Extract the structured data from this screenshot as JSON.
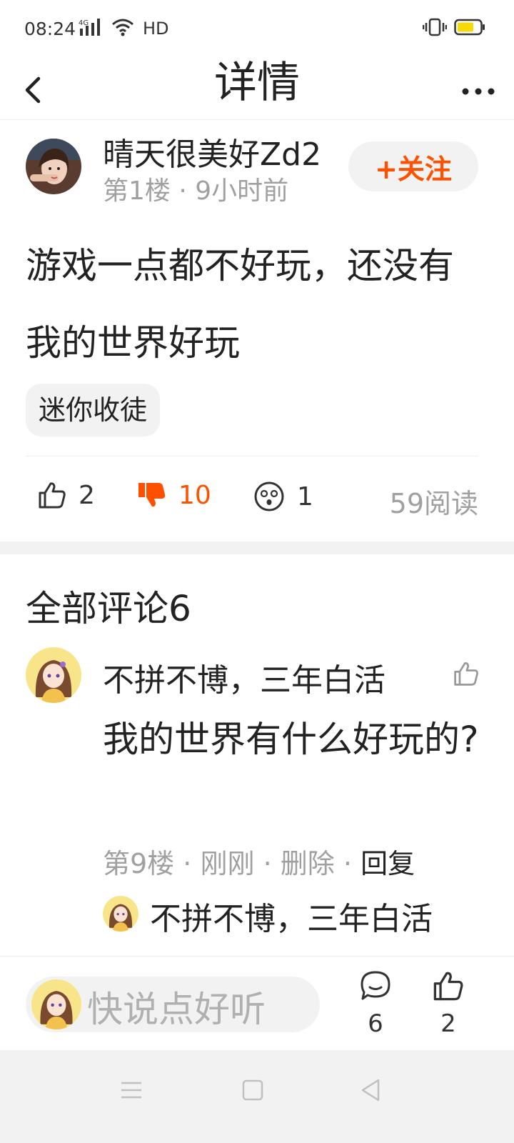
{
  "status_bar": {
    "time": "08:24",
    "network_label": "4G",
    "hd_label": "HD",
    "battery_color": "#f5d90a"
  },
  "nav": {
    "title": "详情",
    "back_icon": "chevron-left-icon",
    "more_icon": "more-horizontal-icon"
  },
  "post": {
    "author": "晴天很美好Zd2",
    "meta": "第1楼 · 9小时前",
    "follow_label": "+关注",
    "content": "游戏一点都不好玩，还没有我的世界好玩",
    "tag": "迷你收徒",
    "actions": {
      "like_count": "2",
      "dislike_count": "10",
      "wow_count": "1",
      "read_count": "59阅读"
    }
  },
  "comments": {
    "title": "全部评论6",
    "items": [
      {
        "author": "不拼不博，三年白活",
        "text": "我的世界有什么好玩的?",
        "floor": "第9楼",
        "time": "刚刚",
        "delete_label": "删除",
        "reply_label": "回复",
        "reply_preview_author": "不拼不博，三年白活"
      }
    ]
  },
  "bottom_bar": {
    "input_placeholder": "快说点好听",
    "comment_count": "6",
    "like_count": "2"
  },
  "colors": {
    "accent": "#ff5000",
    "muted_text": "#a0a0a0",
    "chip_bg": "#f2f2f2"
  }
}
